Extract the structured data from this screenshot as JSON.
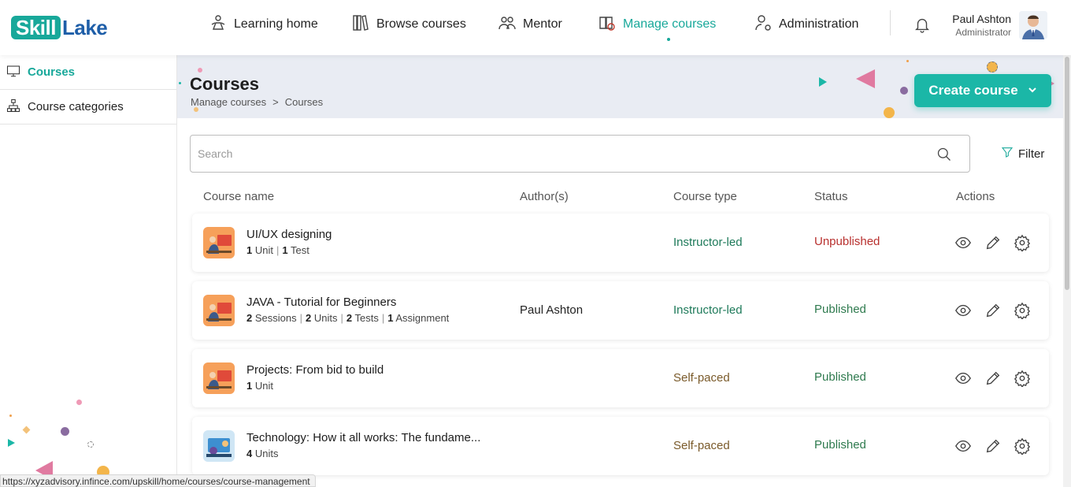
{
  "brand": {
    "logo_part1": "Skill",
    "logo_part2": "Lake"
  },
  "nav": {
    "items": [
      {
        "label": "Learning home",
        "icon": "learning-home-icon"
      },
      {
        "label": "Browse courses",
        "icon": "books-icon"
      },
      {
        "label": "Mentor",
        "icon": "mentor-icon"
      },
      {
        "label": "Manage courses",
        "icon": "manage-courses-icon",
        "active": true
      },
      {
        "label": "Administration",
        "icon": "admin-icon"
      }
    ]
  },
  "user": {
    "name": "Paul Ashton",
    "role": "Administrator"
  },
  "sidebar": {
    "items": [
      {
        "label": "Courses",
        "icon": "monitor-icon",
        "active": true
      },
      {
        "label": "Course categories",
        "icon": "hierarchy-icon"
      }
    ]
  },
  "header": {
    "title": "Courses",
    "breadcrumb": [
      "Manage courses",
      ">",
      "Courses"
    ],
    "create_label": "Create course"
  },
  "search": {
    "placeholder": "Search",
    "value": ""
  },
  "filter_label": "Filter",
  "table": {
    "headers": {
      "name": "Course name",
      "authors": "Author(s)",
      "type": "Course type",
      "status": "Status",
      "actions": "Actions"
    },
    "rows": [
      {
        "name": "UI/UX designing",
        "meta": [
          {
            "n": "1",
            "t": "Unit"
          },
          {
            "n": "1",
            "t": "Test"
          }
        ],
        "author": "",
        "type": "Instructor-led",
        "status": "Unpublished",
        "thumb": "orange"
      },
      {
        "name": "JAVA - Tutorial for Beginners",
        "meta": [
          {
            "n": "2",
            "t": "Sessions"
          },
          {
            "n": "2",
            "t": "Units"
          },
          {
            "n": "2",
            "t": "Tests"
          },
          {
            "n": "1",
            "t": "Assignment"
          }
        ],
        "author": "Paul Ashton",
        "type": "Instructor-led",
        "status": "Published",
        "thumb": "orange"
      },
      {
        "name": "Projects: From bid to build",
        "meta": [
          {
            "n": "1",
            "t": "Unit"
          }
        ],
        "author": "",
        "type": "Self-paced",
        "status": "Published",
        "thumb": "orange"
      },
      {
        "name": "Technology: How it all works: The fundame...",
        "meta": [
          {
            "n": "4",
            "t": "Units"
          }
        ],
        "author": "",
        "type": "Self-paced",
        "status": "Published",
        "thumb": "blue"
      }
    ]
  },
  "status_bar_url": "https://xyzadvisory.infince.com/upskill/home/courses/course-management",
  "colors": {
    "accent": "#18a89a",
    "instructor_led": "#1e7a5a",
    "self_paced": "#7a5a2a",
    "published": "#2e7a4e",
    "unpublished": "#b8302e"
  }
}
